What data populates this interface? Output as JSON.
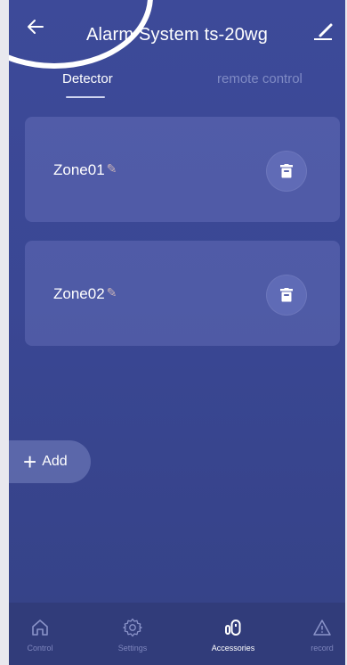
{
  "header": {
    "title": "Alarm System ts-20wg",
    "back_icon": "back-arrow-icon",
    "edit_icon": "edit-icon"
  },
  "tabs": [
    {
      "label": "Detector",
      "active": true
    },
    {
      "label": "remote control",
      "active": false
    }
  ],
  "zones": [
    {
      "name": "Zone01"
    },
    {
      "name": "Zone02"
    }
  ],
  "add_button": {
    "label": "Add"
  },
  "bottom_nav": [
    {
      "label": "Control",
      "icon": "home-icon",
      "active": false
    },
    {
      "label": "Settings",
      "icon": "gear-icon",
      "active": false
    },
    {
      "label": "Accessories",
      "icon": "accessories-icon",
      "active": true
    },
    {
      "label": "record",
      "icon": "warning-icon",
      "active": false
    }
  ],
  "colors": {
    "background": "#3d4a99",
    "card": "#6e79c3",
    "tab_inactive": "#7f8ac4",
    "nav_label": "#7e86bd"
  }
}
